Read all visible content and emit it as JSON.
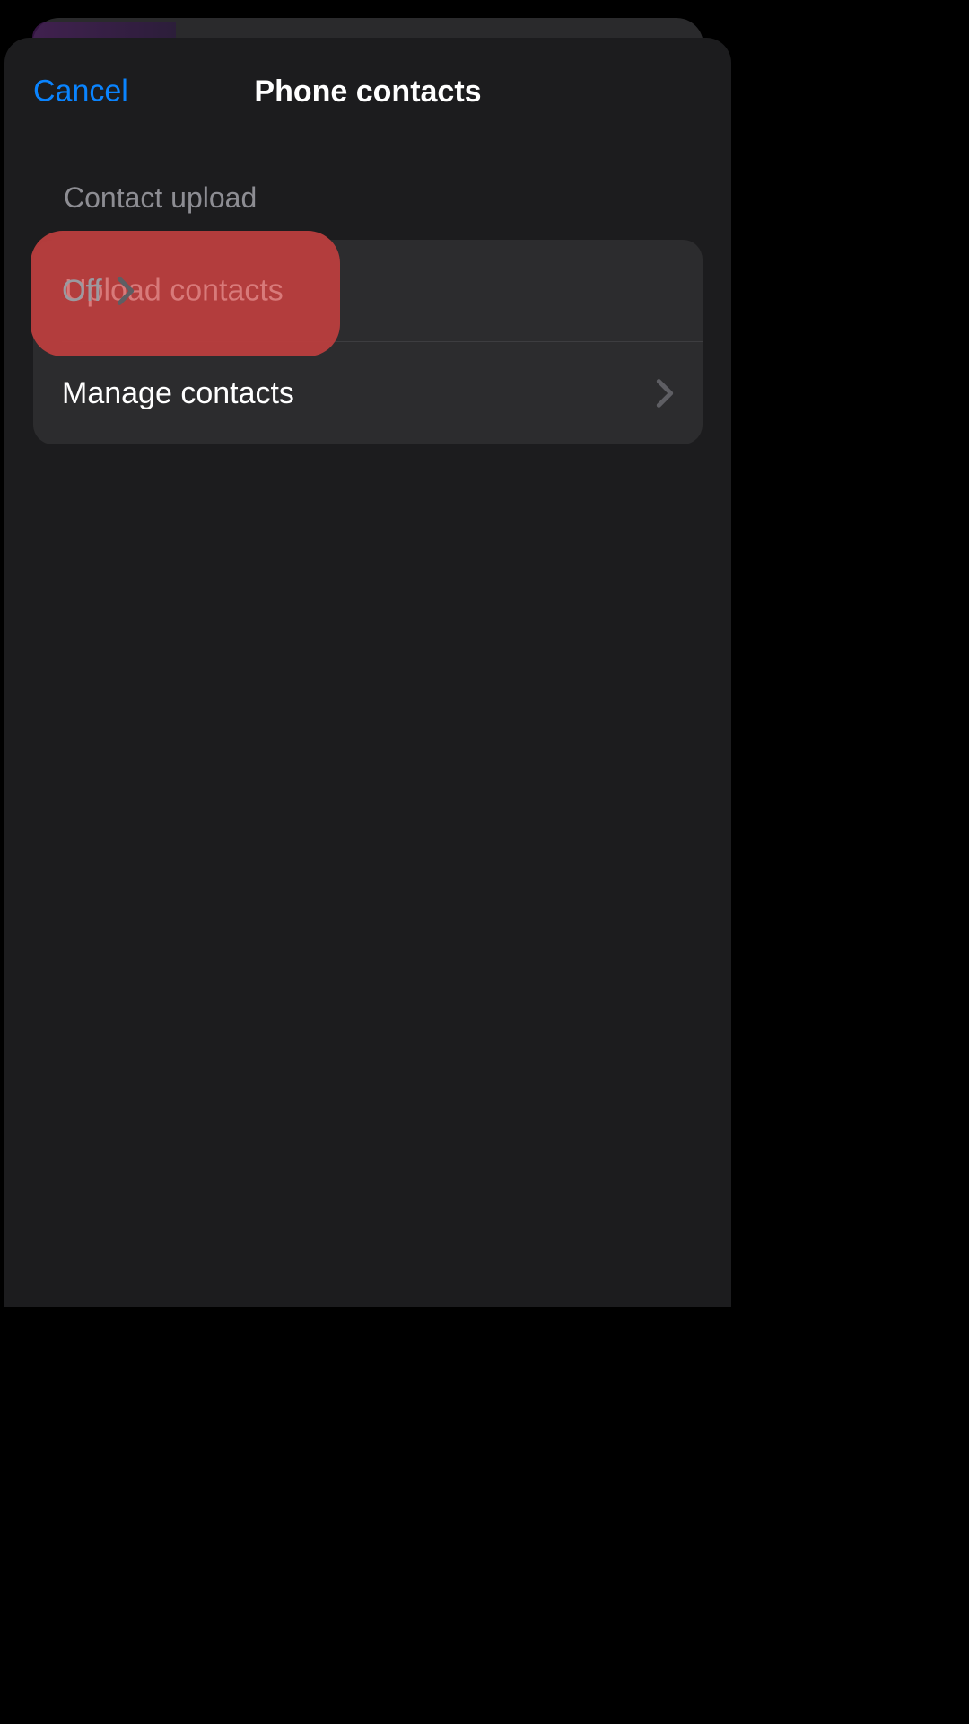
{
  "header": {
    "cancel_label": "Cancel",
    "title": "Phone contacts"
  },
  "section": {
    "header": "Contact upload",
    "rows": [
      {
        "label": "Upload contacts",
        "value": "Off"
      },
      {
        "label": "Manage contacts"
      }
    ]
  }
}
